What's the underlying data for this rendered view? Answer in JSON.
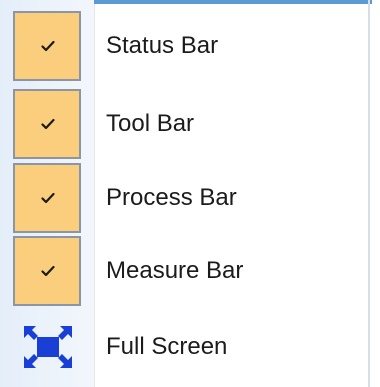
{
  "menu": {
    "items": [
      {
        "label": "Status Bar",
        "checked": true,
        "icon": "check-icon"
      },
      {
        "label": "Tool Bar",
        "checked": true,
        "icon": "check-icon"
      },
      {
        "label": "Process Bar",
        "checked": true,
        "icon": "check-icon"
      },
      {
        "label": "Measure Bar",
        "checked": true,
        "icon": "check-icon"
      },
      {
        "label": "Full Screen",
        "checked": false,
        "icon": "fullscreen-icon"
      }
    ]
  },
  "colors": {
    "check_background": "#fbce7d",
    "check_border": "#8a96a4",
    "fullscreen_icon": "#1a3fd6",
    "gutter": "#e8f0fa",
    "accent_edge": "#5b9bd5"
  }
}
